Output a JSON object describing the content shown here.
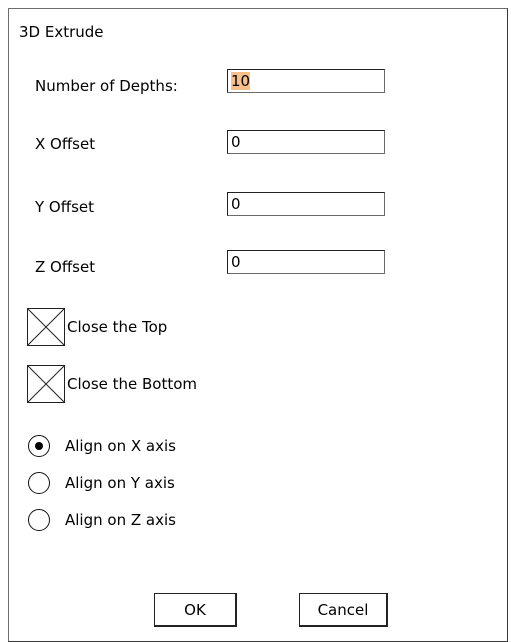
{
  "dialog": {
    "title": "3D Extrude"
  },
  "fields": {
    "depths": {
      "label": "Number of Depths:",
      "value": "10"
    },
    "x_offset": {
      "label": "X Offset",
      "value": "0"
    },
    "y_offset": {
      "label": "Y Offset",
      "value": "0"
    },
    "z_offset": {
      "label": "Z Offset",
      "value": "0"
    }
  },
  "checkboxes": {
    "close_top": {
      "label": "Close the Top",
      "checked": true
    },
    "close_bottom": {
      "label": "Close the Bottom",
      "checked": true
    }
  },
  "radios": {
    "align_x": {
      "label": "Align on X axis",
      "selected": true
    },
    "align_y": {
      "label": "Align on Y axis",
      "selected": false
    },
    "align_z": {
      "label": "Align on Z axis",
      "selected": false
    }
  },
  "buttons": {
    "ok": "OK",
    "cancel": "Cancel"
  },
  "colors": {
    "selection_highlight": "#f7c08a",
    "border": "#222222",
    "background": "#ffffff"
  }
}
